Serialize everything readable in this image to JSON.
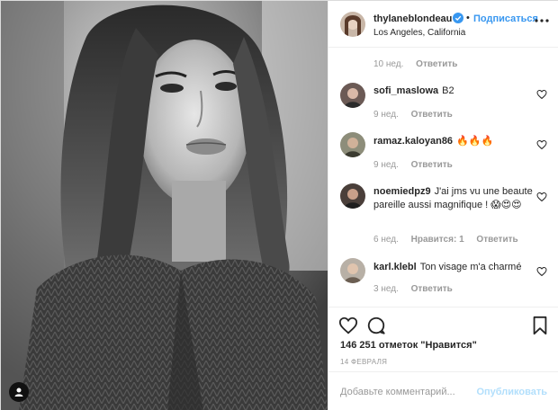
{
  "post": {
    "username": "thylaneblondeau",
    "follow_label": "Подписаться",
    "separator": "•",
    "location": "Los Angeles, California",
    "likes_text": "146 251 отметок \"Нравится\"",
    "date_text": "14 ФЕВРАЛЯ",
    "comment_placeholder": "Добавьте комментарий...",
    "publish_label": "Опубликовать"
  },
  "comments": [
    {
      "user": "",
      "text": "",
      "time": "10 нед.",
      "likes": "",
      "reply": "Ответить"
    },
    {
      "user": "sofi_maslowa",
      "text": "B2",
      "time": "9 нед.",
      "likes": "",
      "reply": "Ответить"
    },
    {
      "user": "ramaz.kaloyan86",
      "text": "🔥🔥🔥",
      "time": "9 нед.",
      "likes": "",
      "reply": "Ответить"
    },
    {
      "user": "noemiedpz9",
      "text": "J'ai jms vu une beaute pareille aussi magnifique ! 😱😍😍",
      "time": "6 нед.",
      "likes": "Нравится: 1",
      "reply": "Ответить"
    },
    {
      "user": "karl.klebl",
      "text": "Ton visage m'a charmé",
      "time": "3 нед.",
      "likes": "",
      "reply": "Ответить"
    }
  ],
  "icons": {
    "verified": "verified-badge-icon",
    "more": "more-options-icon",
    "heart": "heart-icon",
    "comment": "comment-icon",
    "save": "bookmark-icon",
    "user_tag": "user-tag-icon"
  },
  "colors": {
    "accent": "#3897f0",
    "muted": "#999999",
    "publish_disabled": "#b2dffc",
    "border": "#efefef"
  }
}
